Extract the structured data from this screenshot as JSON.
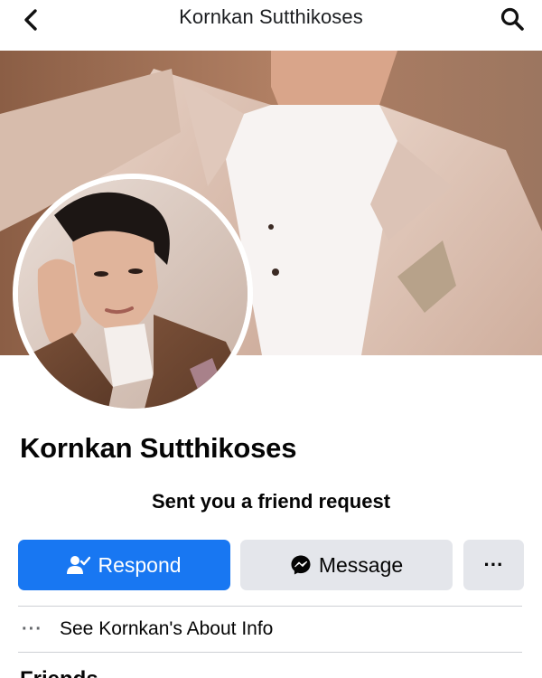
{
  "header": {
    "title": "Kornkan Sutthikoses",
    "back_icon": "chevron-left-icon",
    "search_icon": "search-icon"
  },
  "profile": {
    "name": "Kornkan Sutthikoses",
    "status": "Sent you a friend request"
  },
  "actions": {
    "respond_label": "Respond",
    "message_label": "Message",
    "more_label": "···"
  },
  "about": {
    "label": "See Kornkan's About Info",
    "icon": "···"
  },
  "friends": {
    "label": "Friends"
  },
  "colors": {
    "primary": "#1877f2",
    "secondary_button": "#e4e6eb",
    "text": "#050505",
    "muted": "#65676b",
    "divider": "#ced0d4"
  }
}
